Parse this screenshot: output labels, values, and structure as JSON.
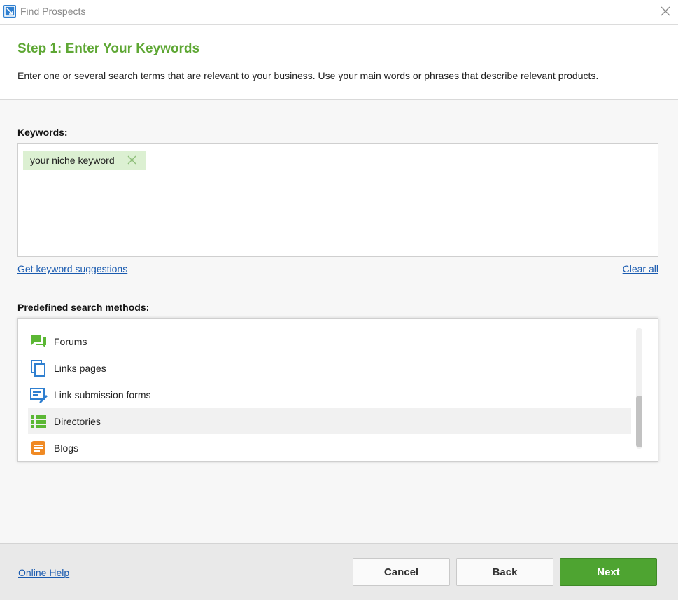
{
  "window": {
    "title": "Find Prospects",
    "app_icon": "app-logo-icon",
    "close_icon": "close-icon"
  },
  "header": {
    "step_title": "Step 1: Enter Your Keywords",
    "description": "Enter one or several search terms that are relevant to your business. Use your main words or phrases that describe relevant products."
  },
  "keywords": {
    "label": "Keywords:",
    "chips": [
      {
        "text": "your niche keyword"
      }
    ],
    "suggest_link": "Get keyword suggestions",
    "clear_link": "Clear all"
  },
  "methods": {
    "label": "Predefined search methods:",
    "items": [
      {
        "label": "Forums",
        "icon": "forum-icon",
        "color": "#5bb734"
      },
      {
        "label": "Links pages",
        "icon": "copy-pages-icon",
        "color": "#2f7fd0"
      },
      {
        "label": "Link submission forms",
        "icon": "form-edit-icon",
        "color": "#2f7fd0"
      },
      {
        "label": "Directories",
        "icon": "list-icon",
        "color": "#5bb734",
        "selected": true
      },
      {
        "label": "Blogs",
        "icon": "blog-icon",
        "color": "#f08a24"
      }
    ]
  },
  "footer": {
    "help_link": "Online Help",
    "cancel_label": "Cancel",
    "back_label": "Back",
    "next_label": "Next"
  },
  "colors": {
    "accent_green": "#5ea734",
    "next_button": "#4ea431",
    "link_blue": "#1a5bb0",
    "chip_bg": "#dcf0d2"
  }
}
